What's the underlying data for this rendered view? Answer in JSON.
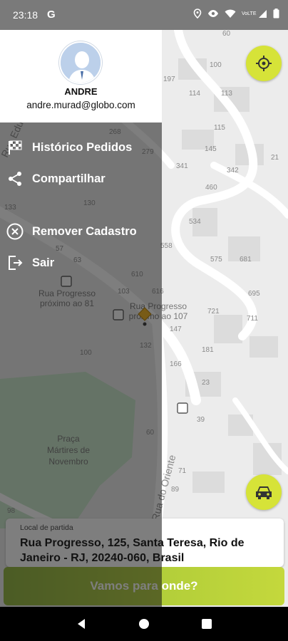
{
  "status_bar": {
    "time": "23:18",
    "google_icon": "G",
    "icons": [
      "location-icon",
      "eye-icon",
      "wifi-icon",
      "signal-icon",
      "battery-icon"
    ],
    "network_label": "VoLTE"
  },
  "map": {
    "colors": {
      "land": "#ececec",
      "road": "#ffffff",
      "park": "#c8e6c9",
      "building": "#dedede",
      "label": "#8a8a8a"
    },
    "street_labels": [
      "Rua Progresso",
      "Rua do Oriente",
      "Rua Eduardo"
    ],
    "place_labels": [
      {
        "text": "Praça Mártires de Novembro"
      },
      {
        "text": "Rua Progresso próximo ao 81"
      },
      {
        "text": "Rua Progresso próximo ao 107"
      }
    ],
    "house_numbers": [
      "60",
      "197",
      "100",
      "114",
      "113",
      "268",
      "279",
      "115",
      "145",
      "341",
      "342",
      "21",
      "460",
      "133",
      "130",
      "534",
      "558",
      "575",
      "681",
      "57",
      "63",
      "610",
      "103",
      "616",
      "695",
      "721",
      "711",
      "147",
      "181",
      "132",
      "100",
      "166",
      "23",
      "39",
      "40",
      "60",
      "71",
      "89",
      "98"
    ]
  },
  "buttons": {
    "locate_icon": "crosshair-icon",
    "car_icon": "car-icon"
  },
  "drawer": {
    "user_name": "ANDRE",
    "user_email": "andre.murad@globo.com",
    "menu": [
      {
        "label": "Histórico Pedidos",
        "icon": "checkered-flag-icon"
      },
      {
        "label": "Compartilhar",
        "icon": "share-icon"
      },
      {
        "label": "Remover Cadastro",
        "icon": "close-circle-icon"
      },
      {
        "label": "Sair",
        "icon": "logout-icon"
      }
    ]
  },
  "address_card": {
    "label": "Local de partida",
    "value": "Rua Progresso, 125, Santa Teresa, Rio de Janeiro - RJ, 20240-060, Brasil"
  },
  "cta": {
    "label": "Vamos para onde?"
  },
  "nav_bar": {
    "icons": [
      "back-icon",
      "home-icon",
      "recents-icon"
    ]
  }
}
